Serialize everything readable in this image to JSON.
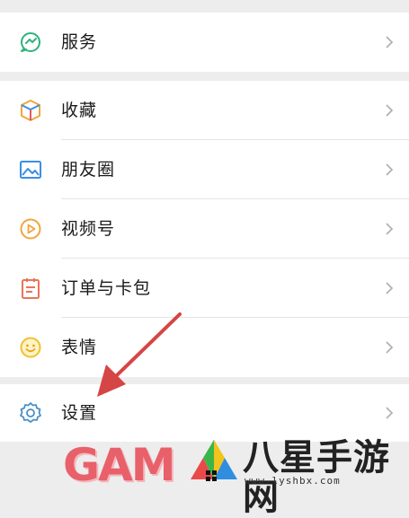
{
  "menu": {
    "services": {
      "label": "服务",
      "icon": "services-icon"
    },
    "items": [
      {
        "label": "收藏",
        "icon": "favorites-cube-icon"
      },
      {
        "label": "朋友圈",
        "icon": "moments-image-icon"
      },
      {
        "label": "视频号",
        "icon": "channels-play-icon"
      },
      {
        "label": "订单与卡包",
        "icon": "orders-cards-icon"
      },
      {
        "label": "表情",
        "icon": "stickers-smile-icon"
      }
    ],
    "settings": {
      "label": "设置",
      "icon": "gear-icon"
    }
  },
  "watermark": {
    "game": "GAM",
    "site_name": "八星手游网",
    "url": "www.lyshbx.com"
  },
  "colors": {
    "background": "#ededed",
    "arrow": "#d64545",
    "services_icon": "#2db37d",
    "settings_icon": "#4a90c8"
  }
}
